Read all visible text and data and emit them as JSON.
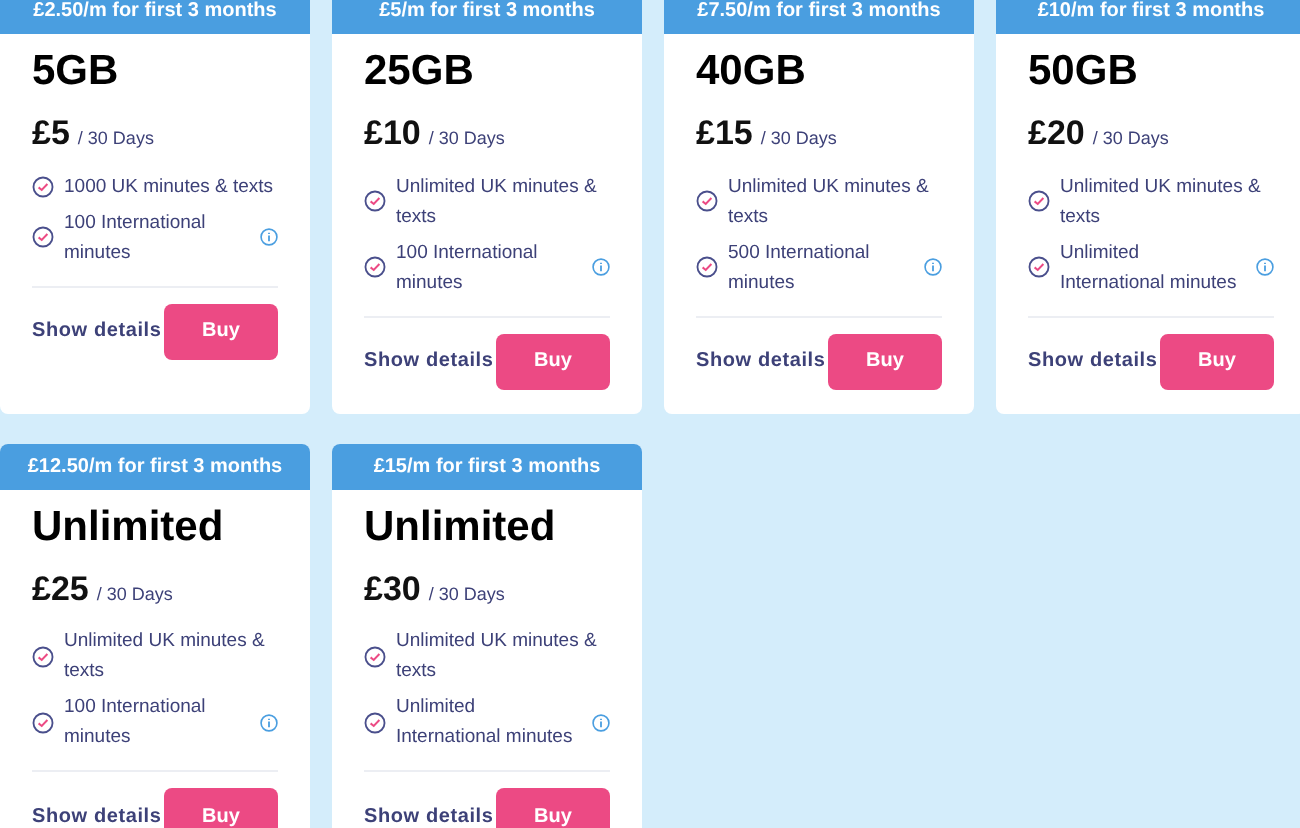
{
  "plans": [
    {
      "promo": "£2.50/m for first 3 months",
      "name": "5GB",
      "price": "£5",
      "period": "/ 30 Days",
      "features": [
        {
          "text": "1000 UK minutes & texts",
          "info": false
        },
        {
          "text": "100 International minutes",
          "info": true
        }
      ],
      "details_label": "Show details",
      "buy_label": "Buy"
    },
    {
      "promo": "£5/m for first 3 months",
      "name": "25GB",
      "price": "£10",
      "period": "/ 30 Days",
      "features": [
        {
          "text": "Unlimited UK minutes & texts",
          "info": false
        },
        {
          "text": "100 International minutes",
          "info": true
        }
      ],
      "details_label": "Show details",
      "buy_label": "Buy"
    },
    {
      "promo": "£7.50/m for first 3 months",
      "name": "40GB",
      "price": "£15",
      "period": "/ 30 Days",
      "features": [
        {
          "text": "Unlimited UK minutes & texts",
          "info": false
        },
        {
          "text": "500 International minutes",
          "info": true
        }
      ],
      "details_label": "Show details",
      "buy_label": "Buy"
    },
    {
      "promo": "£10/m for first 3 months",
      "name": "50GB",
      "price": "£20",
      "period": "/ 30 Days",
      "features": [
        {
          "text": "Unlimited UK minutes & texts",
          "info": false
        },
        {
          "text": "Unlimited International minutes",
          "info": true
        }
      ],
      "details_label": "Show details",
      "buy_label": "Buy"
    },
    {
      "promo": "£12.50/m for first 3 months",
      "name": "Unlimited",
      "price": "£25",
      "period": "/ 30 Days",
      "features": [
        {
          "text": "Unlimited UK minutes & texts",
          "info": false
        },
        {
          "text": "100 International minutes",
          "info": true
        }
      ],
      "details_label": "Show details",
      "buy_label": "Buy"
    },
    {
      "promo": "£15/m for first 3 months",
      "name": "Unlimited",
      "price": "£30",
      "period": "/ 30 Days",
      "features": [
        {
          "text": "Unlimited UK minutes & texts",
          "info": false
        },
        {
          "text": "Unlimited International minutes",
          "info": true
        }
      ],
      "details_label": "Show details",
      "buy_label": "Buy"
    }
  ]
}
